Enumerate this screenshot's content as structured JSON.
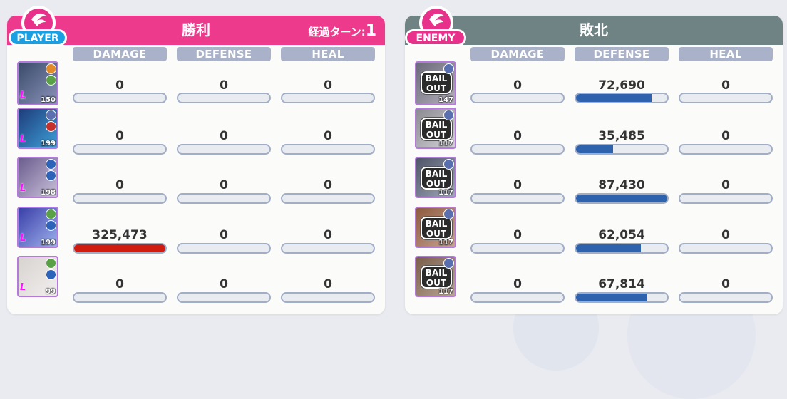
{
  "player": {
    "badge": "PLAYER",
    "result": "勝利",
    "turn_label": "経過ターン:",
    "turn_value": "1",
    "columns": [
      "DAMAGE",
      "DEFENSE",
      "HEAL"
    ],
    "rows": [
      {
        "level": "150",
        "damage": "0",
        "defense": "0",
        "heal": "0",
        "damage_fill": 0,
        "colors": [
          "#3a4a6b",
          "#8a93b8"
        ],
        "elem": "#e08a2a",
        "elem2": "#5aa046"
      },
      {
        "level": "199",
        "damage": "0",
        "defense": "0",
        "heal": "0",
        "damage_fill": 0,
        "colors": [
          "#1e3c7a",
          "#3d9fd8"
        ],
        "elem": "#5a6fb0",
        "elem2": "#c6302d"
      },
      {
        "level": "198",
        "damage": "0",
        "defense": "0",
        "heal": "0",
        "damage_fill": 0,
        "colors": [
          "#6b5c8e",
          "#c9c1d9"
        ],
        "elem": "#2d63b8",
        "elem2": "#2d63b8"
      },
      {
        "level": "199",
        "damage": "325,473",
        "defense": "0",
        "heal": "0",
        "damage_fill": 1,
        "colors": [
          "#3a3fa8",
          "#9db0ec"
        ],
        "elem": "#5aa046",
        "elem2": "#2d63b8"
      },
      {
        "level": "99",
        "damage": "0",
        "defense": "0",
        "heal": "0",
        "damage_fill": 0,
        "colors": [
          "#d7d3cf",
          "#f1eeee"
        ],
        "elem": "#5aa046",
        "elem2": "#2d63b8"
      }
    ]
  },
  "enemy": {
    "badge": "ENEMY",
    "result": "敗北",
    "columns": [
      "DAMAGE",
      "DEFENSE",
      "HEAL"
    ],
    "bail_text": [
      "BAIL",
      "OUT"
    ],
    "rows": [
      {
        "level": "147",
        "damage": "0",
        "defense": "72,690",
        "heal": "0",
        "defense_fill": 0.83,
        "colors": [
          "#6b6a7a",
          "#b3aeba"
        ]
      },
      {
        "level": "117",
        "damage": "0",
        "defense": "35,485",
        "heal": "0",
        "defense_fill": 0.41,
        "colors": [
          "#8a8a90",
          "#d3d1d8"
        ]
      },
      {
        "level": "117",
        "damage": "0",
        "defense": "87,430",
        "heal": "0",
        "defense_fill": 1.0,
        "colors": [
          "#4d5566",
          "#a1a7b9"
        ]
      },
      {
        "level": "117",
        "damage": "0",
        "defense": "62,054",
        "heal": "0",
        "defense_fill": 0.71,
        "colors": [
          "#8d5a3e",
          "#c8a392"
        ]
      },
      {
        "level": "117",
        "damage": "0",
        "defense": "67,814",
        "heal": "0",
        "defense_fill": 0.78,
        "colors": [
          "#7a5f4a",
          "#b9a496"
        ]
      }
    ]
  }
}
